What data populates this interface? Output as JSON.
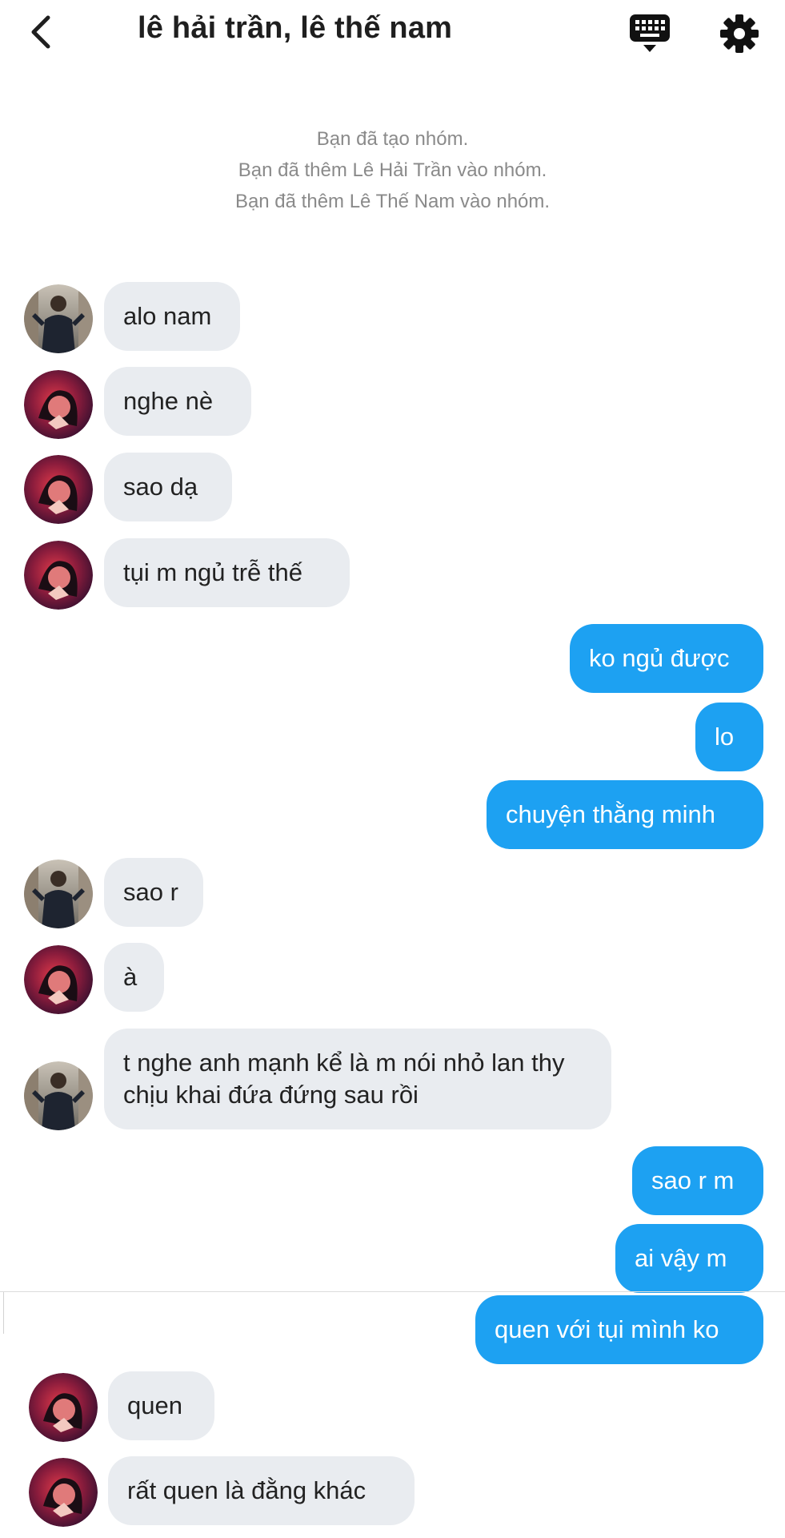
{
  "header": {
    "title": "lê hải trần, lê thế nam",
    "back_icon": "chevron-left-icon",
    "keyboard_icon": "keyboard-icon",
    "settings_icon": "gear-icon"
  },
  "system_messages": [
    "Bạn đã tạo nhóm.",
    "Bạn đã thêm Lê Hải Trần vào nhóm.",
    "Bạn đã thêm Lê Thế Nam vào nhóm."
  ],
  "messages": [
    {
      "sender": "lê thế nam",
      "direction": "in",
      "text": "alo nam"
    },
    {
      "sender": "lê hải trần",
      "direction": "in",
      "text": "nghe nè"
    },
    {
      "sender": "lê hải trần",
      "direction": "in",
      "text": "sao dạ"
    },
    {
      "sender": "lê hải trần",
      "direction": "in",
      "text": "tụi m ngủ trễ thế"
    },
    {
      "sender": "me",
      "direction": "out",
      "text": "ko ngủ được"
    },
    {
      "sender": "me",
      "direction": "out",
      "text": "lo"
    },
    {
      "sender": "me",
      "direction": "out",
      "text": "chuyện thằng minh"
    },
    {
      "sender": "lê thế nam",
      "direction": "in",
      "text": "sao r"
    },
    {
      "sender": "lê hải trần",
      "direction": "in",
      "text": "à"
    },
    {
      "sender": "lê thế nam",
      "direction": "in",
      "text": "t nghe anh mạnh kể là m nói nhỏ lan thy chịu khai đứa đứng sau rồi"
    },
    {
      "sender": "me",
      "direction": "out",
      "text": "sao r m"
    },
    {
      "sender": "me",
      "direction": "out",
      "text": "ai vậy m"
    },
    {
      "sender": "me",
      "direction": "out",
      "text": "quen với tụi mình ko"
    },
    {
      "sender": "lê hải trần",
      "direction": "in",
      "text": "quen"
    },
    {
      "sender": "lê hải trần",
      "direction": "in",
      "text": "rất quen là đằng khác"
    }
  ],
  "colors": {
    "outgoing_bubble": "#1da1f2",
    "incoming_bubble": "#e9ecf0",
    "system_text": "#8a8a8a"
  }
}
